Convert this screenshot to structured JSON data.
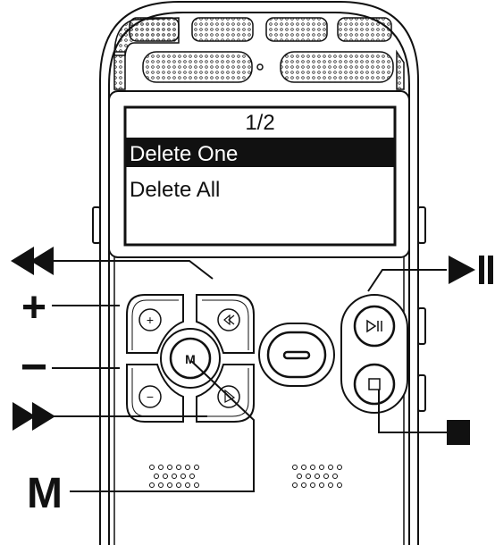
{
  "screen": {
    "page_indicator": "1/2",
    "menu_items": [
      {
        "label": "Delete One",
        "selected": true
      },
      {
        "label": "Delete All",
        "selected": false
      }
    ]
  },
  "callouts": {
    "volume_up": "+",
    "volume_down": "−",
    "menu": "M"
  },
  "buttons": {
    "plus_glyph": "+",
    "minus_glyph": "−",
    "menu_glyph": "M"
  },
  "colors": {
    "ink": "#111111",
    "device_fill": "#ffffff",
    "highlight_bg": "#111111",
    "highlight_text": "#ffffff"
  },
  "icons": {
    "rewind_callout": "double-left-triangle-icon",
    "forward_callout": "double-right-triangle-icon",
    "play_pause_callout": "play-pause-icon",
    "stop_callout": "stop-square-icon"
  }
}
